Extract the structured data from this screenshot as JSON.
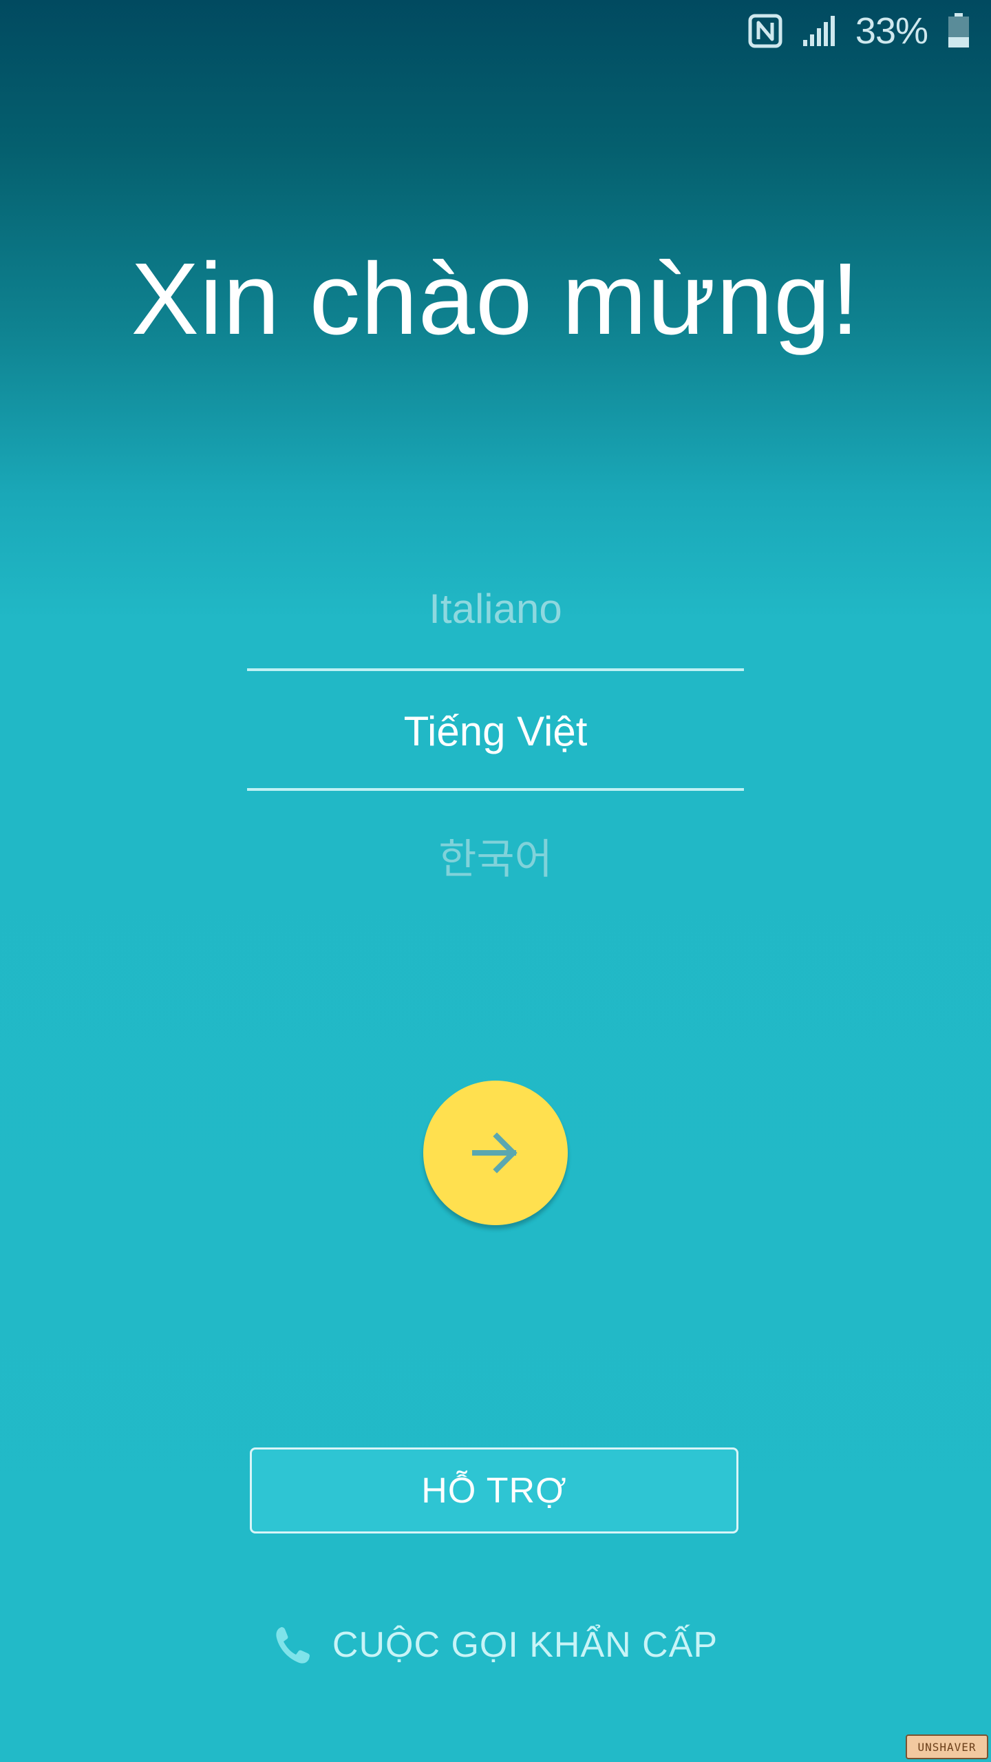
{
  "status_bar": {
    "icons": [
      "nfc-icon",
      "signal-icon",
      "battery-icon"
    ],
    "battery_percent": "33%",
    "battery_level": 0.33
  },
  "title": "Xin chào mừng!",
  "language_picker": {
    "previous": "Italiano",
    "selected": "Tiếng Việt",
    "next": "한국어"
  },
  "next_button": {
    "icon": "arrow-right-icon",
    "color": "#ffe04f"
  },
  "support_button": {
    "label": "HỖ TRỢ"
  },
  "emergency_call": {
    "icon": "phone-icon",
    "label": "CUỘC GỌI KHẨN CẤP"
  },
  "watermark": "UNSHAVER",
  "colors": {
    "background_top": "#014a60",
    "background_main": "#22bac8",
    "accent": "#ffe04f"
  }
}
